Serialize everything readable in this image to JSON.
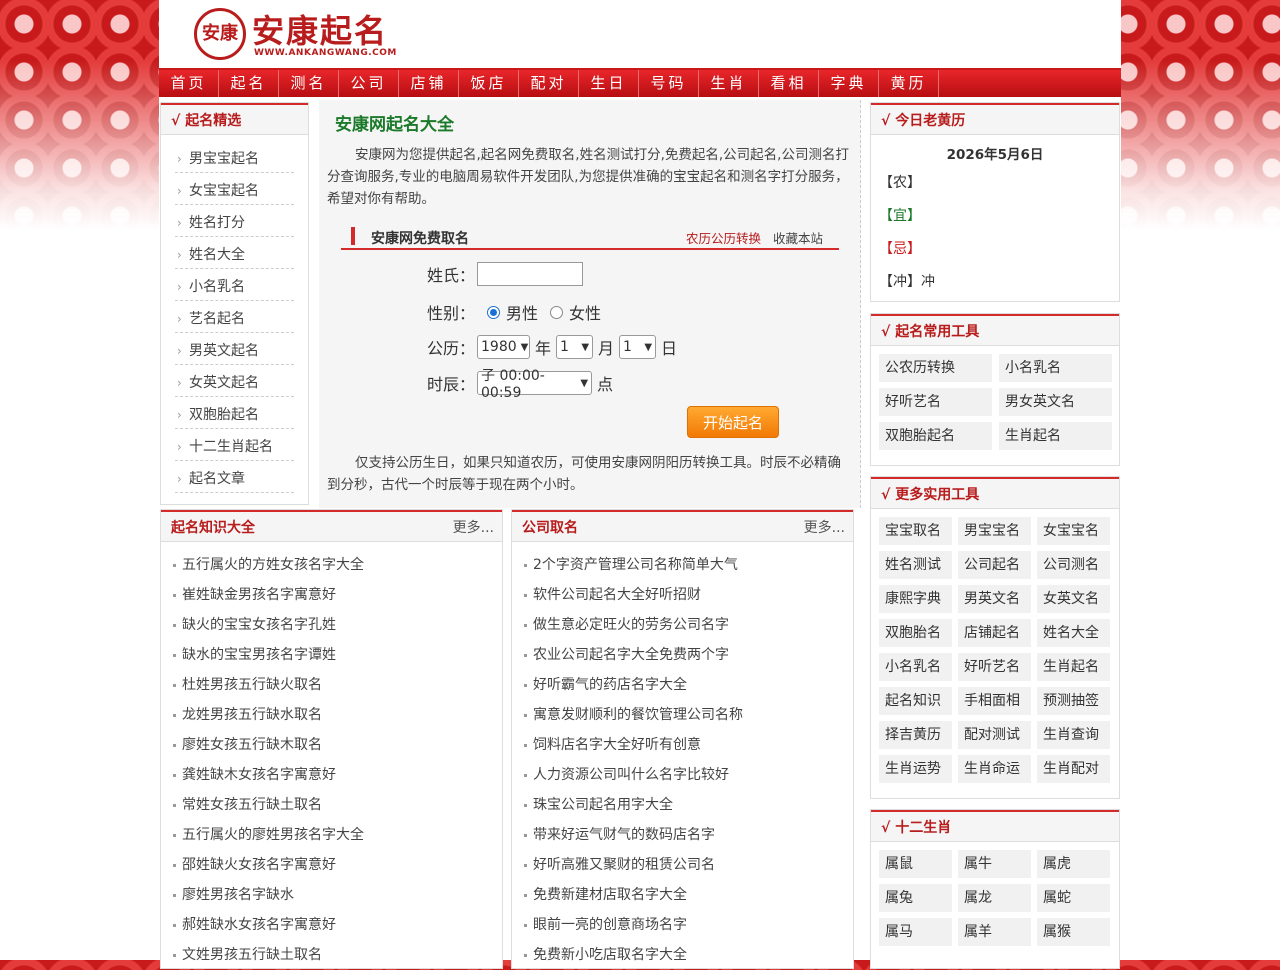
{
  "site": {
    "logo_seal": "安康",
    "logo_text": "安康起名",
    "logo_sub": "WWW.ANKANGWANG.COM"
  },
  "nav": [
    "首页",
    "起名",
    "测名",
    "公司",
    "店铺",
    "饭店",
    "配对",
    "生日",
    "号码",
    "生肖",
    "看相",
    "字典",
    "黄历"
  ],
  "left_menu": {
    "title": "√ 起名精选",
    "items": [
      "男宝宝起名",
      "女宝宝起名",
      "姓名打分",
      "姓名大全",
      "小名乳名",
      "艺名起名",
      "男英文起名",
      "女英文起名",
      "双胞胎起名",
      "十二生肖起名",
      "起名文章"
    ]
  },
  "main": {
    "title": "安康网起名大全",
    "intro": "安康网为您提供起名,起名网免费取名,姓名测试打分,免费起名,公司起名,公司测名打分查询服务,专业的电脑周易软件开发团队,为您提供准确的宝宝起名和测名字打分服务，希望对你有帮助。",
    "form_title": "安康网免费取名",
    "link_calendar": "农历公历转换",
    "link_bookmark": "收藏本站",
    "surname_label": "姓氏：",
    "gender_label": "性别：",
    "male": "男性",
    "female": "女性",
    "calendar_label": "公历：",
    "year": "1980",
    "year_unit": "年",
    "month": "1",
    "month_unit": "月",
    "day": "1",
    "day_unit": "日",
    "hour_label": "时辰：",
    "hour": "子 00:00-00:59",
    "hour_unit": "点",
    "start_button": "开始起名",
    "note": "仅支持公历生日，如果只知道农历，可使用安康网阴阳历转换工具。时辰不必精确到分秒，古代一个时辰等于现在两个小时。"
  },
  "knowledge": {
    "title": "起名知识大全",
    "more": "更多...",
    "items": [
      "五行属火的方姓女孩名字大全",
      "崔姓缺金男孩名字寓意好",
      "缺火的宝宝女孩名字孔姓",
      "缺水的宝宝男孩名字谭姓",
      "杜姓男孩五行缺火取名",
      "龙姓男孩五行缺水取名",
      "廖姓女孩五行缺木取名",
      "龚姓缺木女孩名字寓意好",
      "常姓女孩五行缺土取名",
      "五行属火的廖姓男孩名字大全",
      "邵姓缺火女孩名字寓意好",
      "廖姓男孩名字缺水",
      "郝姓缺水女孩名字寓意好",
      "文姓男孩五行缺土取名"
    ]
  },
  "company": {
    "title": "公司取名",
    "more": "更多...",
    "items": [
      "2个字资产管理公司名称简单大气",
      "软件公司起名大全好听招财",
      "做生意必定旺火的劳务公司名字",
      "农业公司起名字大全免费两个字",
      "好听霸气的药店名字大全",
      "寓意发财顺利的餐饮管理公司名称",
      "饲料店名字大全好听有创意",
      "人力资源公司叫什么名字比较好",
      "珠宝公司起名用字大全",
      "带来好运气财气的数码店名字",
      "好听高雅又聚财的租赁公司名",
      "免费新建材店取名字大全",
      "眼前一亮的创意商场名字",
      "免费新小吃店取名字大全"
    ]
  },
  "almanac": {
    "title": "√ 今日老黄历",
    "date": "2026年5月6日",
    "nong": "【农】",
    "yi": "【宜】",
    "ji": "【忌】",
    "chong": "【冲】冲"
  },
  "tools": {
    "title": "√ 起名常用工具",
    "items": [
      "公农历转换",
      "小名乳名",
      "好听艺名",
      "男女英文名",
      "双胞胎起名",
      "生肖起名"
    ]
  },
  "more_tools": {
    "title": "√ 更多实用工具",
    "items": [
      "宝宝取名",
      "男宝宝名",
      "女宝宝名",
      "姓名测试",
      "公司起名",
      "公司测名",
      "康熙字典",
      "男英文名",
      "女英文名",
      "双胞胎名",
      "店铺起名",
      "姓名大全",
      "小名乳名",
      "好听艺名",
      "生肖起名",
      "起名知识",
      "手相面相",
      "预测抽签",
      "择吉黄历",
      "配对测试",
      "生肖查询",
      "生肖运势",
      "生肖命运",
      "生肖配对"
    ]
  },
  "zodiac": {
    "title": "√ 十二生肖",
    "items": [
      "属鼠",
      "属牛",
      "属虎",
      "属兔",
      "属龙",
      "属蛇",
      "属马",
      "属羊",
      "属猴"
    ]
  },
  "colors": {
    "brand_red": "#b81c1c",
    "nav_red": "#d61e22",
    "title_green": "#1b7a2a",
    "button_orange": "#f58c12"
  }
}
